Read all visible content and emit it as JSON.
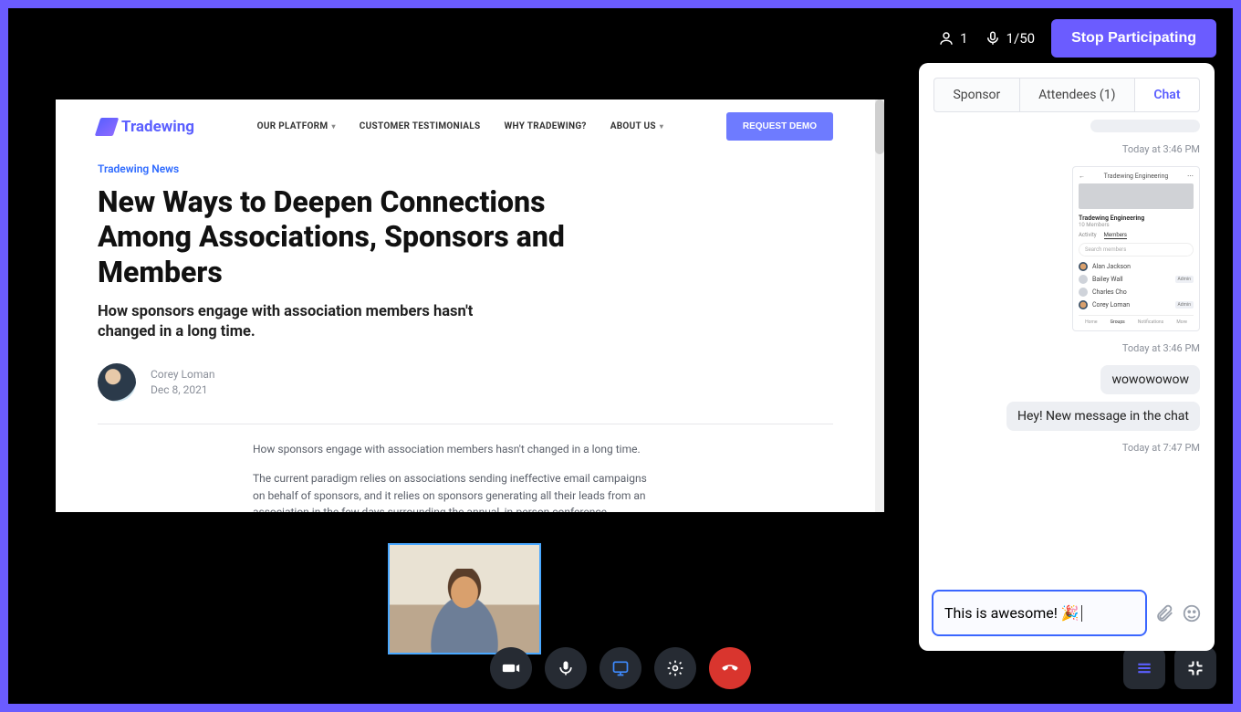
{
  "header": {
    "participants": "1",
    "mic_stat": "1/50",
    "stop_label": "Stop Participating"
  },
  "shared": {
    "brand": "Tradewing",
    "nav": {
      "platform": "OUR PLATFORM",
      "testimonials": "CUSTOMER TESTIMONIALS",
      "why": "WHY TRADEWING?",
      "about": "ABOUT US"
    },
    "demo_btn": "REQUEST DEMO",
    "breadcrumb": "Tradewing News",
    "title": "New Ways to Deepen Connections Among Associations, Sponsors and Members",
    "subtitle": "How sponsors engage with association members hasn't changed in a long time.",
    "author": "Corey Loman",
    "date": "Dec 8, 2021",
    "p1": "How sponsors engage with association members hasn't changed in a long time.",
    "p2": "The current paradigm relies on associations sending ineffective email campaigns on behalf of sponsors, and it relies on sponsors generating all their leads from an association in the few days surrounding the annual, in-person conference."
  },
  "chat": {
    "tabs": {
      "sponsor": "Sponsor",
      "attendees": "Attendees (1)",
      "chat": "Chat"
    },
    "ts1": "Today at 3:46 PM",
    "ts2": "Today at 3:46 PM",
    "ts3": "Today at 7:47 PM",
    "m1": "wowowowow",
    "m2": "Hey! New message in the chat",
    "compose": "This is awesome! 🎉",
    "embed": {
      "header": "Tradewing Engineering",
      "title": "Tradewing Engineering",
      "subtitle": "10 Members",
      "tab_activity": "Activity",
      "tab_members": "Members",
      "search": "Search members",
      "members": [
        {
          "name": "Alan Jackson",
          "badge": ""
        },
        {
          "name": "Bailey Wall",
          "badge": "Admin"
        },
        {
          "name": "Charles Cho",
          "badge": ""
        },
        {
          "name": "Corey Loman",
          "badge": "Admin"
        }
      ],
      "bottom": {
        "home": "Home",
        "groups": "Groups",
        "notif": "Notifications",
        "more": "More"
      }
    }
  }
}
